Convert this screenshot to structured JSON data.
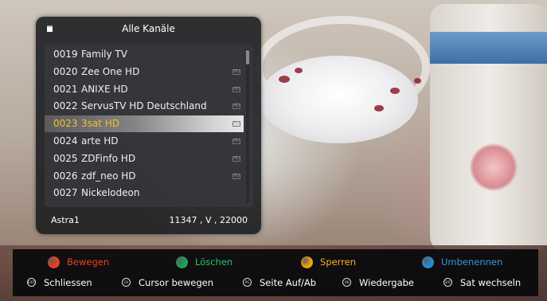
{
  "dialog": {
    "title": "Alle Kanäle",
    "channels": [
      {
        "number": "0019",
        "name": "Family TV",
        "hd": false
      },
      {
        "number": "0020",
        "name": "Zee One HD",
        "hd": true
      },
      {
        "number": "0021",
        "name": "ANIXE HD",
        "hd": true
      },
      {
        "number": "0022",
        "name": "ServusTV HD Deutschland",
        "hd": true
      },
      {
        "number": "0023",
        "name": "3sat HD",
        "hd": true,
        "selected": true
      },
      {
        "number": "0024",
        "name": "arte HD",
        "hd": true
      },
      {
        "number": "0025",
        "name": "ZDFinfo HD",
        "hd": true
      },
      {
        "number": "0026",
        "name": "zdf_neo HD",
        "hd": true
      },
      {
        "number": "0027",
        "name": "Nickelodeon",
        "hd": false
      }
    ],
    "hd_badge": "HD",
    "footer_satellite": "Astra1",
    "footer_transponder": "11347 , V , 22000"
  },
  "color_keys": [
    {
      "label": "Bewegen",
      "color": "#e8401c",
      "text_color": "#e8401c",
      "icon": "red-button-icon"
    },
    {
      "label": "Löschen",
      "color": "#19a35a",
      "text_color": "#27c46a",
      "icon": "green-button-icon"
    },
    {
      "label": "Sperren",
      "color": "#f2a20c",
      "text_color": "#f5b21b",
      "icon": "yellow-button-icon"
    },
    {
      "label": "Umbenennen",
      "color": "#1d8fd6",
      "text_color": "#2d9be0",
      "icon": "blue-button-icon"
    }
  ],
  "nav_keys": [
    {
      "label": "Schliessen",
      "icon_text": "EXIT",
      "icon": "exit-button-icon"
    },
    {
      "label": "Cursor bewegen",
      "icon_text": "CH",
      "icon": "ch-button-icon"
    },
    {
      "label": "Seite Auf/Ab",
      "icon_text": "PG",
      "icon": "page-button-icon"
    },
    {
      "label": "Wiedergabe",
      "icon_text": "OK",
      "icon": "ok-button-icon"
    },
    {
      "label": "Sat wechseln",
      "icon_text": "SAT",
      "icon": "sat-button-icon"
    }
  ]
}
